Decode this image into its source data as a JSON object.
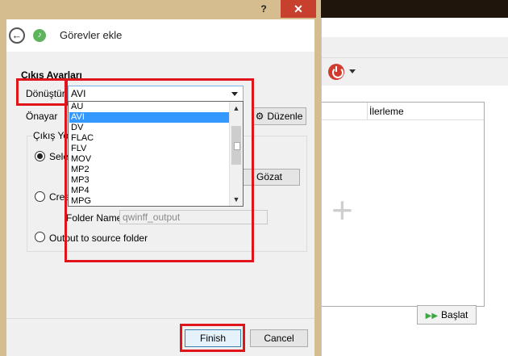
{
  "dialog": {
    "help_glyph": "?",
    "close_glyph": "✕",
    "back_glyph": "←",
    "title": "Görevler ekle",
    "section_title": "Çıkış Ayarları",
    "convert_label": "Dönüştür",
    "convert_value": "AVI",
    "preset_label": "Önayar",
    "edit_button": "Düzenle",
    "edit_icon": "gear-icon",
    "output_group_label": "Çıkış Yolu",
    "radio_selected_partial": "Sele",
    "radio_create_partial": "Crea",
    "browse_button": "Gözat",
    "folder_name_label": "Folder Name",
    "folder_name_value": "qwinff_output",
    "radio_source_label": "Output to source folder",
    "finish_button": "Finish",
    "cancel_button": "Cancel"
  },
  "dropdown": {
    "items": [
      "AU",
      "AVI",
      "DV",
      "FLAC",
      "FLV",
      "MOV",
      "MP2",
      "MP3",
      "MP4",
      "MPG"
    ],
    "selected": "AVI"
  },
  "background_window": {
    "column_progress": "İlerleme",
    "start_button": "Başlat",
    "power_icon": "power-icon",
    "watermark": "+"
  },
  "colors": {
    "highlight_red": "#e0141b",
    "selection_blue": "#3399ff",
    "close_red": "#c7402e"
  }
}
